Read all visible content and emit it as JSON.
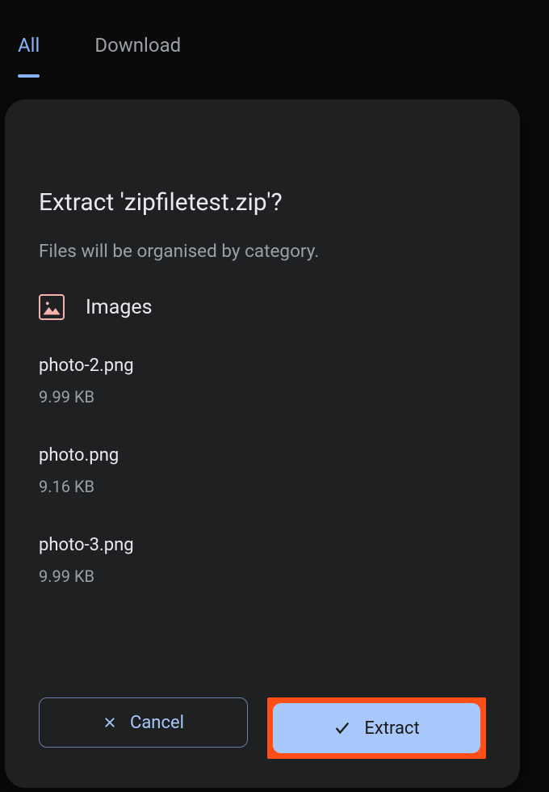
{
  "tabs": {
    "all": "All",
    "download": "Download"
  },
  "dialog": {
    "title": "Extract 'zipfiletest.zip'?",
    "subtitle": "Files will be organised by category.",
    "category": "Images",
    "files": [
      {
        "name": "photo-2.png",
        "size": "9.99 KB"
      },
      {
        "name": "photo.png",
        "size": "9.16 KB"
      },
      {
        "name": "photo-3.png",
        "size": "9.99 KB"
      }
    ],
    "cancel_label": "Cancel",
    "extract_label": "Extract"
  }
}
